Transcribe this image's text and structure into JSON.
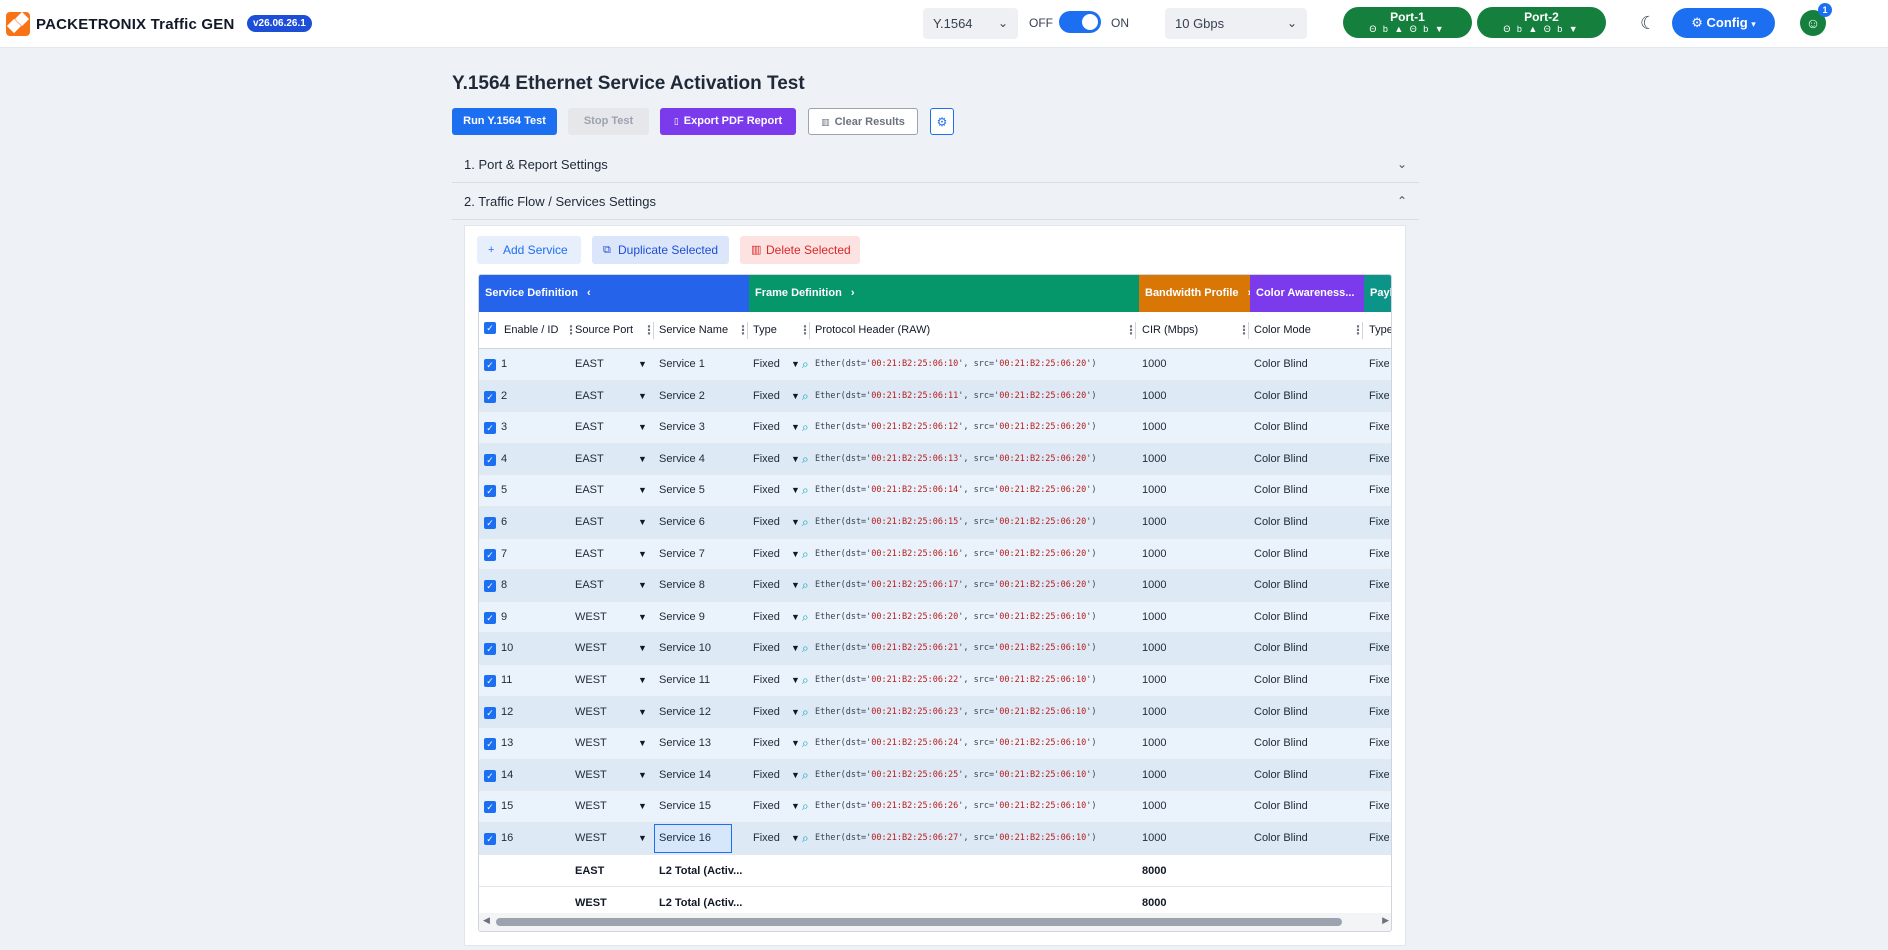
{
  "app": {
    "brand": "PACKETRONIX Traffic GEN",
    "version": "v26.06.26.1",
    "mode_select": "Y.1564",
    "toggle_off": "OFF",
    "toggle_on": "ON",
    "speed_select": "10 Gbps",
    "ports": [
      {
        "name": "Port-1",
        "status": "Θ b ▲   Θ b ▼"
      },
      {
        "name": "Port-2",
        "status": "Θ b ▲   Θ b ▼"
      }
    ],
    "config_label": "Config",
    "users_badge": "1"
  },
  "page": {
    "title": "Y.1564 Ethernet Service Activation Test",
    "buttons": {
      "run": "Run Y.1564 Test",
      "stop": "Stop Test",
      "export": "Export PDF Report",
      "clear": "Clear Results"
    },
    "sections": [
      {
        "label": "1. Port & Report Settings",
        "expanded": false
      },
      {
        "label": "2. Traffic Flow / Services Settings",
        "expanded": true
      }
    ]
  },
  "services_panel": {
    "add": "Add Service",
    "duplicate": "Duplicate Selected",
    "delete": "Delete Selected"
  },
  "grid": {
    "groups": [
      {
        "label": "Service Definition",
        "arrow": "‹",
        "color": "#2563eb"
      },
      {
        "label": "Frame Definition",
        "arrow": "›",
        "color": "#059669"
      },
      {
        "label": "Bandwidth Profile",
        "arrow": "›",
        "color": "#d97706"
      },
      {
        "label": "Color Awareness...",
        "arrow": "›",
        "color": "#7c3aed"
      },
      {
        "label": "Paylo",
        "arrow": "",
        "color": "#0d9488"
      }
    ],
    "columns": {
      "enable": "Enable / ID",
      "source": "Source Port",
      "name": "Service Name",
      "type": "Type",
      "proto": "Protocol Header (RAW)",
      "cir": "CIR (Mbps)",
      "color_mode": "Color Mode",
      "payload_type": "Type"
    },
    "rows": [
      {
        "id": "1",
        "src": "EAST",
        "name": "Service 1",
        "type": "Fixed",
        "dst": "00:21:B2:25:06:10",
        "srcmac": "00:21:B2:25:06:20",
        "cir": "1000",
        "color": "Color Blind",
        "ptype": "Fixed"
      },
      {
        "id": "2",
        "src": "EAST",
        "name": "Service 2",
        "type": "Fixed",
        "dst": "00:21:B2:25:06:11",
        "srcmac": "00:21:B2:25:06:20",
        "cir": "1000",
        "color": "Color Blind",
        "ptype": "Fixed"
      },
      {
        "id": "3",
        "src": "EAST",
        "name": "Service 3",
        "type": "Fixed",
        "dst": "00:21:B2:25:06:12",
        "srcmac": "00:21:B2:25:06:20",
        "cir": "1000",
        "color": "Color Blind",
        "ptype": "Fixed"
      },
      {
        "id": "4",
        "src": "EAST",
        "name": "Service 4",
        "type": "Fixed",
        "dst": "00:21:B2:25:06:13",
        "srcmac": "00:21:B2:25:06:20",
        "cir": "1000",
        "color": "Color Blind",
        "ptype": "Fixed"
      },
      {
        "id": "5",
        "src": "EAST",
        "name": "Service 5",
        "type": "Fixed",
        "dst": "00:21:B2:25:06:14",
        "srcmac": "00:21:B2:25:06:20",
        "cir": "1000",
        "color": "Color Blind",
        "ptype": "Fixed"
      },
      {
        "id": "6",
        "src": "EAST",
        "name": "Service 6",
        "type": "Fixed",
        "dst": "00:21:B2:25:06:15",
        "srcmac": "00:21:B2:25:06:20",
        "cir": "1000",
        "color": "Color Blind",
        "ptype": "Fixed"
      },
      {
        "id": "7",
        "src": "EAST",
        "name": "Service 7",
        "type": "Fixed",
        "dst": "00:21:B2:25:06:16",
        "srcmac": "00:21:B2:25:06:20",
        "cir": "1000",
        "color": "Color Blind",
        "ptype": "Fixed"
      },
      {
        "id": "8",
        "src": "EAST",
        "name": "Service 8",
        "type": "Fixed",
        "dst": "00:21:B2:25:06:17",
        "srcmac": "00:21:B2:25:06:20",
        "cir": "1000",
        "color": "Color Blind",
        "ptype": "Fixed"
      },
      {
        "id": "9",
        "src": "WEST",
        "name": "Service 9",
        "type": "Fixed",
        "dst": "00:21:B2:25:06:20",
        "srcmac": "00:21:B2:25:06:10",
        "cir": "1000",
        "color": "Color Blind",
        "ptype": "Fixed"
      },
      {
        "id": "10",
        "src": "WEST",
        "name": "Service 10",
        "type": "Fixed",
        "dst": "00:21:B2:25:06:21",
        "srcmac": "00:21:B2:25:06:10",
        "cir": "1000",
        "color": "Color Blind",
        "ptype": "Fixed"
      },
      {
        "id": "11",
        "src": "WEST",
        "name": "Service 11",
        "type": "Fixed",
        "dst": "00:21:B2:25:06:22",
        "srcmac": "00:21:B2:25:06:10",
        "cir": "1000",
        "color": "Color Blind",
        "ptype": "Fixed"
      },
      {
        "id": "12",
        "src": "WEST",
        "name": "Service 12",
        "type": "Fixed",
        "dst": "00:21:B2:25:06:23",
        "srcmac": "00:21:B2:25:06:10",
        "cir": "1000",
        "color": "Color Blind",
        "ptype": "Fixed"
      },
      {
        "id": "13",
        "src": "WEST",
        "name": "Service 13",
        "type": "Fixed",
        "dst": "00:21:B2:25:06:24",
        "srcmac": "00:21:B2:25:06:10",
        "cir": "1000",
        "color": "Color Blind",
        "ptype": "Fixed"
      },
      {
        "id": "14",
        "src": "WEST",
        "name": "Service 14",
        "type": "Fixed",
        "dst": "00:21:B2:25:06:25",
        "srcmac": "00:21:B2:25:06:10",
        "cir": "1000",
        "color": "Color Blind",
        "ptype": "Fixed"
      },
      {
        "id": "15",
        "src": "WEST",
        "name": "Service 15",
        "type": "Fixed",
        "dst": "00:21:B2:25:06:26",
        "srcmac": "00:21:B2:25:06:10",
        "cir": "1000",
        "color": "Color Blind",
        "ptype": "Fixed"
      },
      {
        "id": "16",
        "src": "WEST",
        "name": "Service 16",
        "type": "Fixed",
        "dst": "00:21:B2:25:06:27",
        "srcmac": "00:21:B2:25:06:10",
        "cir": "1000",
        "color": "Color Blind",
        "ptype": "Fixed"
      }
    ],
    "selected_row_id": "16",
    "totals": [
      {
        "src": "EAST",
        "label": "L2 Total (Activ...",
        "cir": "8000"
      },
      {
        "src": "WEST",
        "label": "L2 Total (Activ...",
        "cir": "8000"
      }
    ]
  }
}
